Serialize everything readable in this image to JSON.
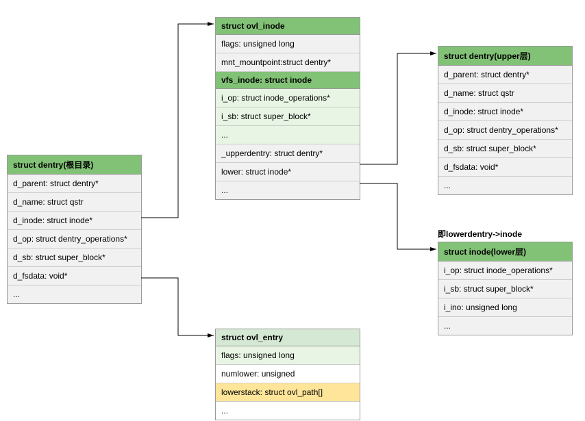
{
  "dentry_root": {
    "title": "struct dentry(根目录)",
    "fields": [
      "d_parent: struct dentry*",
      "d_name: struct qstr",
      "d_inode: struct inode*",
      "d_op: struct dentry_operations*",
      "d_sb: struct super_block*",
      "d_fsdata: void*",
      "..."
    ]
  },
  "ovl_inode": {
    "title": "struct ovl_inode",
    "fields_top": [
      "flags: unsigned long",
      "mnt_mountpoint:struct dentry*"
    ],
    "vfs_header": "vfs_inode: struct inode",
    "vfs_fields": [
      "i_op: struct inode_operations*",
      "i_sb: struct super_block*",
      "..."
    ],
    "fields_bottom": [
      "_upperdentry: struct dentry*",
      "lower: struct inode*",
      "..."
    ]
  },
  "dentry_upper": {
    "title": "struct dentry(upper层)",
    "fields": [
      "d_parent: struct dentry*",
      "d_name: struct qstr",
      "d_inode: struct inode*",
      "d_op: struct dentry_operations*",
      "d_sb: struct super_block*",
      "d_fsdata: void*",
      "..."
    ]
  },
  "inode_lower": {
    "annotation": "即lowerdentry->inode",
    "title": "struct inode(lower层)",
    "fields": [
      "i_op: struct inode_operations*",
      "i_sb: struct super_block*",
      "i_ino: unsigned long",
      "..."
    ]
  },
  "ovl_entry": {
    "title": "struct ovl_entry",
    "fields": [
      {
        "text": "flags: unsigned long",
        "style": "row-lightgreen"
      },
      {
        "text": "numlower: unsigned",
        "style": "row-white"
      },
      {
        "text": "lowerstack: struct ovl_path[]",
        "style": "row-yellow"
      },
      {
        "text": "...",
        "style": "row-white"
      }
    ]
  },
  "chart_data": {
    "type": "diagram",
    "nodes": [
      {
        "id": "dentry_root",
        "label": "struct dentry(根目录)"
      },
      {
        "id": "ovl_inode",
        "label": "struct ovl_inode"
      },
      {
        "id": "dentry_upper",
        "label": "struct dentry(upper层)"
      },
      {
        "id": "inode_lower",
        "label": "struct inode(lower层)"
      },
      {
        "id": "ovl_entry",
        "label": "struct ovl_entry"
      }
    ],
    "edges": [
      {
        "from": "dentry_root",
        "from_field": "d_inode",
        "to": "ovl_inode"
      },
      {
        "from": "dentry_root",
        "from_field": "d_fsdata",
        "to": "ovl_entry"
      },
      {
        "from": "ovl_inode",
        "from_field": "_upperdentry",
        "to": "dentry_upper"
      },
      {
        "from": "ovl_inode",
        "from_field": "lower",
        "to": "inode_lower"
      }
    ]
  }
}
